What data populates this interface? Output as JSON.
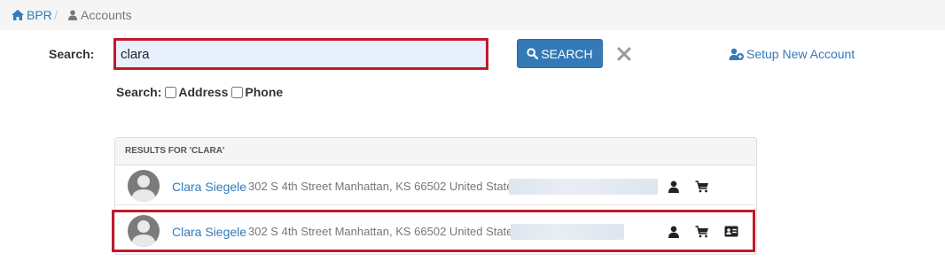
{
  "breadcrumb": {
    "home": "BPR",
    "separator": "/",
    "current": "Accounts"
  },
  "search": {
    "label": "Search:",
    "value": "clara",
    "button_label": "SEARCH",
    "clear_icon": "close-icon",
    "setup_link": "Setup New Account",
    "options_label": "Search:",
    "options": [
      {
        "label": "Address",
        "checked": false
      },
      {
        "label": "Phone",
        "checked": false
      }
    ]
  },
  "results": {
    "header": "RESULTS FOR 'CLARA'",
    "rows": [
      {
        "name": "Clara Siegele",
        "address": "302 S 4th Street Manhattan, KS 66502 United States",
        "icons": [
          "user-icon",
          "cart-icon"
        ]
      },
      {
        "name": "Clara Siegele",
        "address": "302 S 4th Street Manhattan, KS 66502 United States",
        "icons": [
          "user-icon",
          "cart-icon",
          "id-card-icon"
        ]
      }
    ]
  },
  "colors": {
    "accent": "#337ab7",
    "highlight": "#c0192c",
    "input_bg": "#e8f0fe"
  }
}
